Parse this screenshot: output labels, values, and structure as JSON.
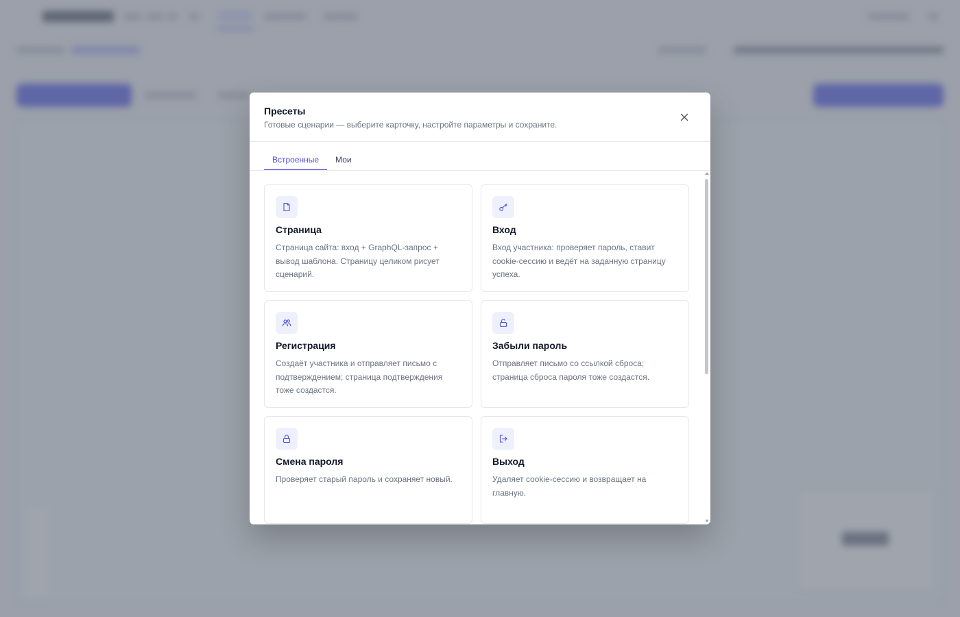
{
  "modal": {
    "title": "Пресеты",
    "subtitle": "Готовые сценарии — выберите карточку, настройте параметры и сохраните.",
    "close_icon": "close-icon"
  },
  "tabs": [
    {
      "label": "Встроенные",
      "active": true
    },
    {
      "label": "Мои",
      "active": false
    }
  ],
  "presets": [
    {
      "icon": "file-icon",
      "title": "Страница",
      "description": "Страница сайта: вход + GraphQL-запрос + вывод шаблона. Страницу целиком рисует сценарий."
    },
    {
      "icon": "key-icon",
      "title": "Вход",
      "description": "Вход участника: проверяет пароль, ставит cookie-сессию и ведёт на заданную страницу успеха."
    },
    {
      "icon": "users-icon",
      "title": "Регистрация",
      "description": "Создаёт участника и отправляет письмо с подтверждением; страница подтверждения тоже создастся."
    },
    {
      "icon": "unlock-icon",
      "title": "Забыли пароль",
      "description": "Отправляет письмо со ссылкой сброса; страница сброса пароля тоже создастся."
    },
    {
      "icon": "lock-icon",
      "title": "Смена пароля",
      "description": "Проверяет старый пароль и сохраняет новый."
    },
    {
      "icon": "logout-icon",
      "title": "Выход",
      "description": "Удаляет cookie-сессию и возвращает на главную."
    }
  ],
  "colors": {
    "accent": "#4f52d9",
    "icon_bg": "#eef0fd",
    "overlay": "#6b7280"
  }
}
